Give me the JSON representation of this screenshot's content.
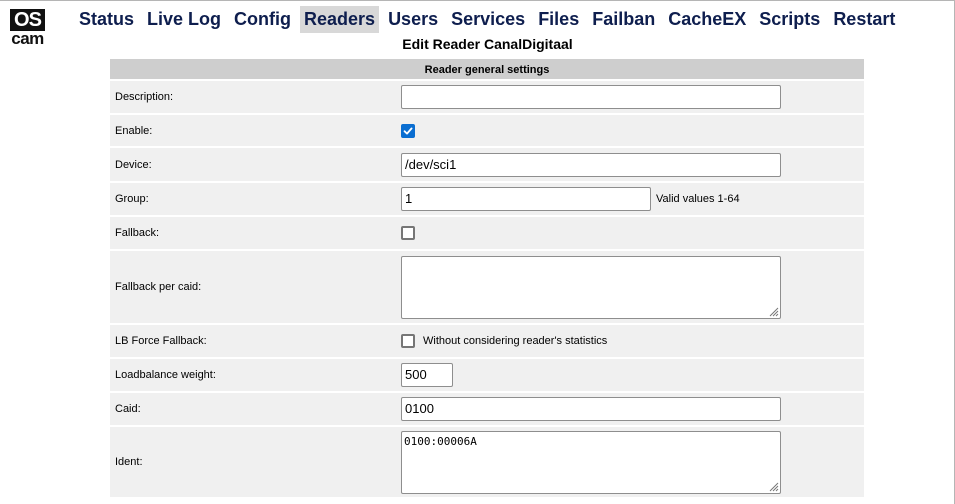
{
  "logo": {
    "top": "OS",
    "bottom": "cam"
  },
  "nav": [
    {
      "label": "Status"
    },
    {
      "label": "Live Log"
    },
    {
      "label": "Config"
    },
    {
      "label": "Readers",
      "active": true
    },
    {
      "label": "Users"
    },
    {
      "label": "Services"
    },
    {
      "label": "Files"
    },
    {
      "label": "Failban"
    },
    {
      "label": "CacheEX"
    },
    {
      "label": "Scripts"
    },
    {
      "label": "Restart"
    }
  ],
  "page_title": "Edit Reader CanalDigitaal",
  "section_title": "Reader general settings",
  "fields": {
    "description": {
      "label": "Description:",
      "value": ""
    },
    "enable": {
      "label": "Enable:",
      "checked": true
    },
    "device": {
      "label": "Device:",
      "value": "/dev/sci1"
    },
    "group": {
      "label": "Group:",
      "value": "1",
      "hint": "Valid values 1-64"
    },
    "fallback": {
      "label": "Fallback:",
      "checked": false
    },
    "fallback_per_caid": {
      "label": "Fallback per caid:",
      "value": ""
    },
    "lb_force_fallback": {
      "label": "LB Force Fallback:",
      "checked": false,
      "hint": "Without considering reader's statistics"
    },
    "loadbalance_weight": {
      "label": "Loadbalance weight:",
      "value": "500"
    },
    "caid": {
      "label": "Caid:",
      "value": "0100"
    },
    "ident": {
      "label": "Ident:",
      "value": "0100:00006A"
    }
  },
  "colors": {
    "nav_text": "#0e1e4e",
    "nav_active_bg": "#d8d8d8",
    "header_bg": "#cecece",
    "row_bg": "#f0f0f0",
    "checkbox_checked": "#0a6ed1"
  }
}
